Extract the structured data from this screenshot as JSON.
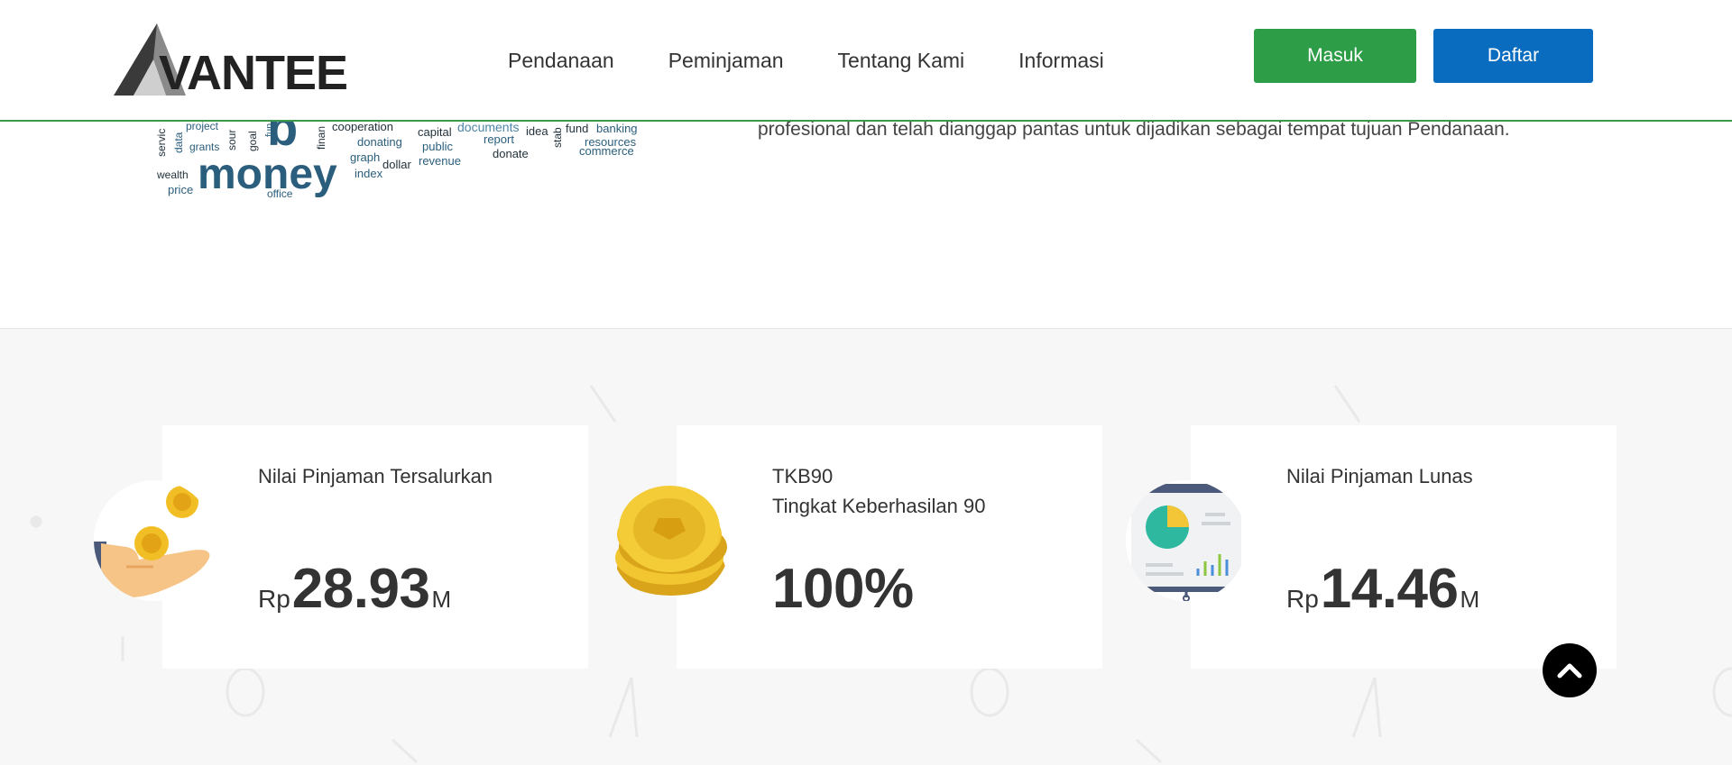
{
  "header": {
    "logo_text": "VANTEE",
    "nav": [
      "Pendanaan",
      "Peminjaman",
      "Tentang Kami",
      "Informasi"
    ],
    "login_label": "Masuk",
    "register_label": "Daftar",
    "colors": {
      "login": "#2e9d47",
      "register": "#0a6cbf",
      "divider": "#3d9a4d"
    }
  },
  "intro": {
    "text": "profesional dan telah dianggap pantas untuk dijadikan sebagai tempat tujuan Pendanaan.",
    "wordcloud": [
      "project",
      "servic",
      "data",
      "grants",
      "sour",
      "goal",
      "fun",
      "b",
      "finan",
      "cooperation",
      "donating",
      "graph",
      "dollar",
      "index",
      "capital",
      "public",
      "revenue",
      "documents",
      "report",
      "donate",
      "idea",
      "stab",
      "fund",
      "banking",
      "resources",
      "commerce",
      "wealth",
      "money",
      "price",
      "office"
    ]
  },
  "stats": [
    {
      "label_lines": [
        "Nilai Pinjaman Tersalurkan"
      ],
      "prefix": "Rp",
      "value": "28.93",
      "suffix": "M",
      "icon": "hand-coins-icon"
    },
    {
      "label_lines": [
        "TKB90",
        "Tingkat Keberhasilan 90"
      ],
      "prefix": "",
      "value": "100%",
      "suffix": "",
      "icon": "coin-stack-icon"
    },
    {
      "label_lines": [
        "Nilai Pinjaman Lunas"
      ],
      "prefix": "Rp",
      "value": "14.46",
      "suffix": "M",
      "icon": "presentation-chart-icon"
    }
  ],
  "scroll_top_icon": "chevron-up-icon"
}
